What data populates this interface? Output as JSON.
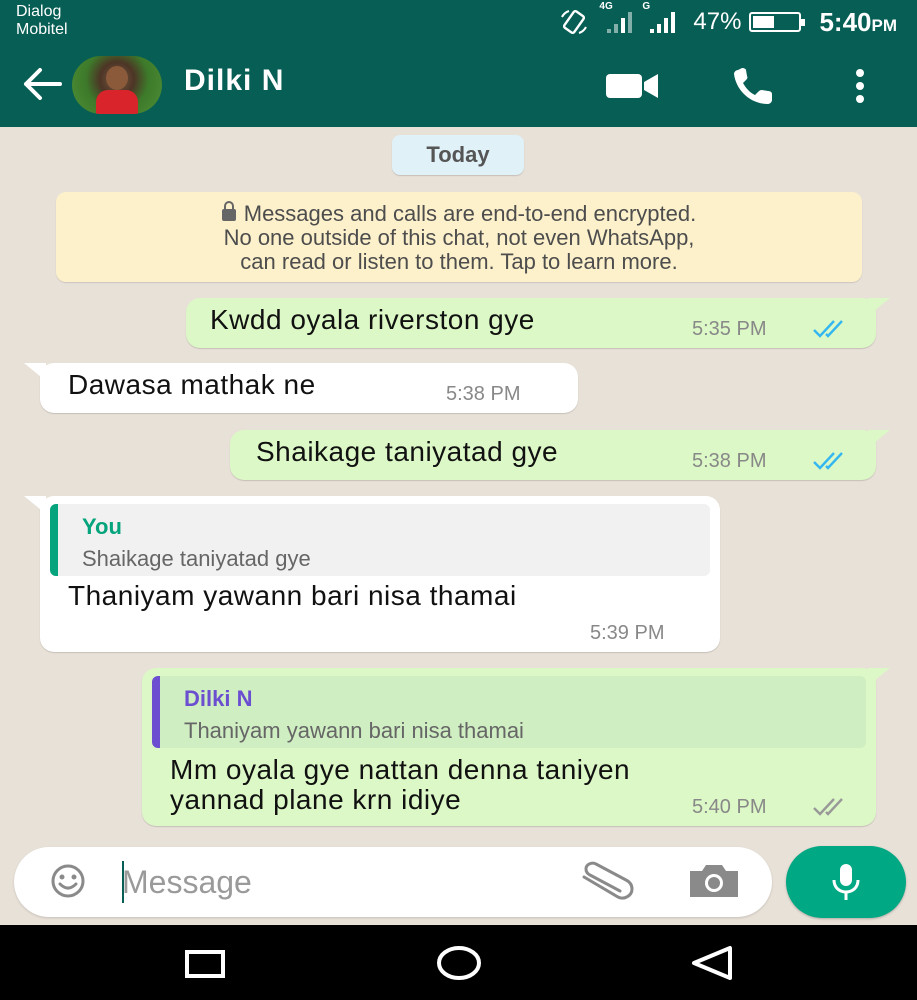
{
  "status_bar": {
    "carrier_line1": "Dialog",
    "carrier_line2": "Mobitel",
    "net1": "4G",
    "net2": "G",
    "battery_text": "47%",
    "battery_level": 0.47,
    "time_main": "5:40",
    "time_suffix": "PM"
  },
  "header": {
    "contact_name": "Dilki N",
    "bg_color": "#075e54"
  },
  "chat": {
    "date_chip": "Today",
    "encryption_notice": {
      "line1": "Messages and calls are end-to-end encrypted.",
      "line2": "No one outside of this chat, not even WhatsApp,",
      "line3": "can read or listen to them. Tap to learn more."
    },
    "messages": [
      {
        "direction": "out",
        "text": "Kwdd oyala riverston  gye",
        "time": "5:35 PM",
        "status": "read"
      },
      {
        "direction": "in",
        "text": "Dawasa mathak ne",
        "time": "5:38 PM"
      },
      {
        "direction": "out",
        "text": "Shaikage taniyatad gye",
        "time": "5:38 PM",
        "status": "read"
      },
      {
        "direction": "in",
        "quote_name": "You",
        "quote_text": "Shaikage taniyatad gye",
        "text": "Thaniyam yawann bari nisa thamai",
        "time": "5:39 PM"
      },
      {
        "direction": "out",
        "quote_name": "Dilki N",
        "quote_text": "Thaniyam yawann bari nisa thamai",
        "text_line1": "Mm oyala gye nattan denna taniyen",
        "text_line2": "yannad plane krn idiye",
        "time": "5:40 PM",
        "status": "delivered"
      }
    ]
  },
  "composer": {
    "placeholder": "Message"
  },
  "colors": {
    "outgoing_bubble": "#dcf8c6",
    "incoming_bubble": "#ffffff",
    "read_ticks": "#34b7f1",
    "delivered_ticks": "#999999",
    "accent": "#00a884",
    "quote_you": "#06a47c",
    "quote_contact": "#6b4fd0"
  }
}
